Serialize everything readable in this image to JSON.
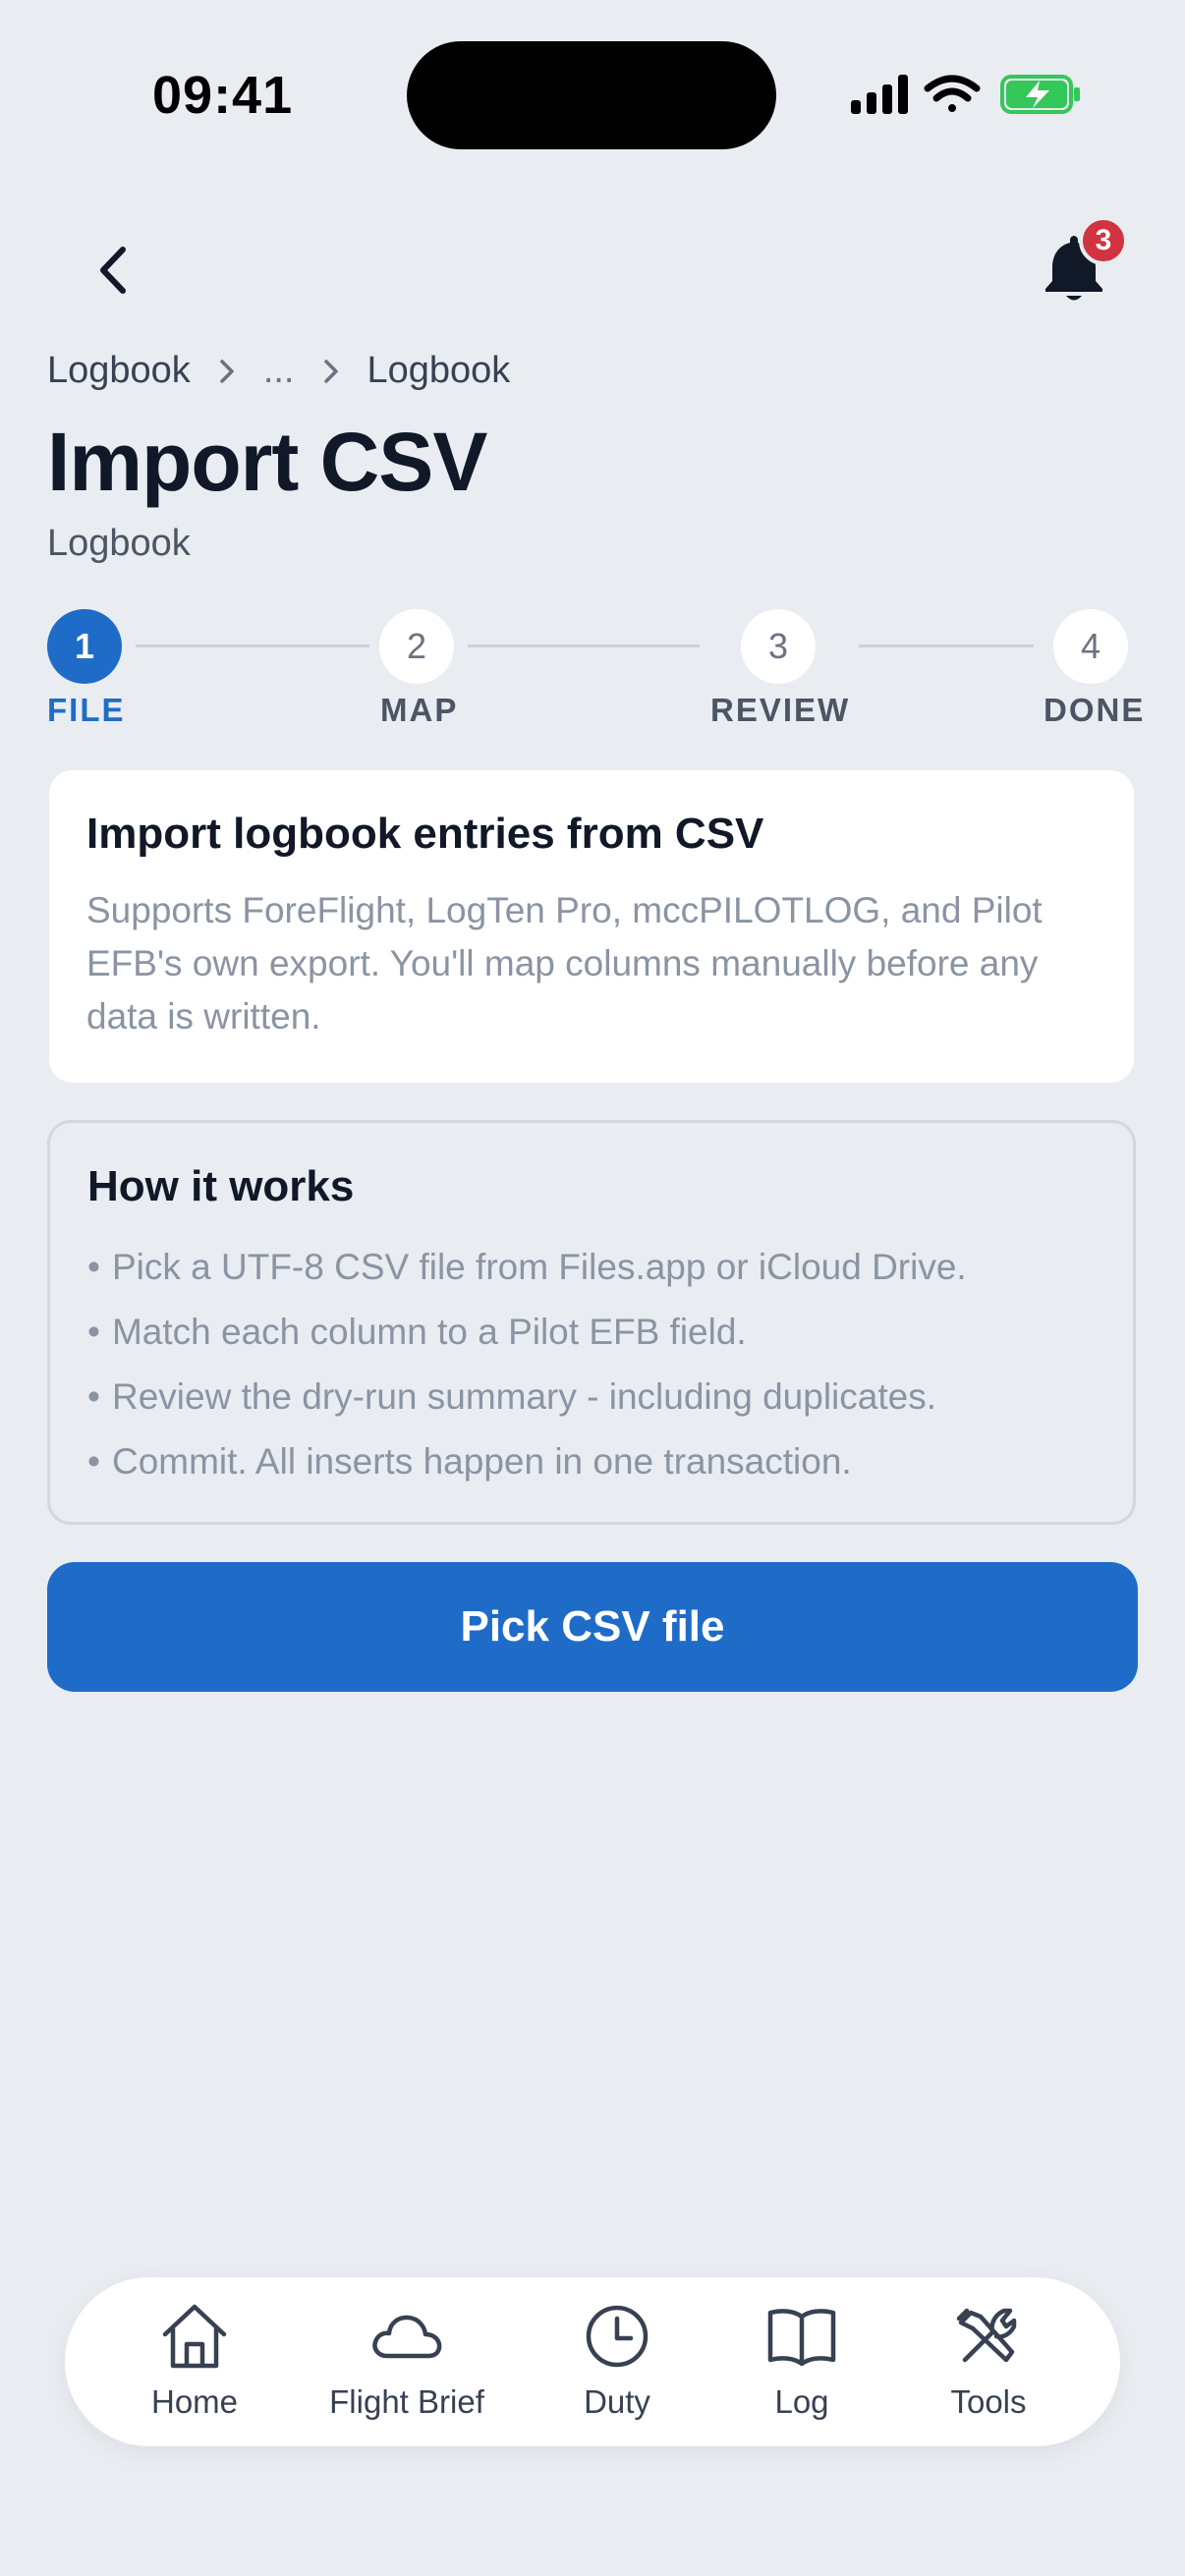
{
  "status_bar": {
    "time": "09:41"
  },
  "header": {
    "notification_count": "3"
  },
  "breadcrumb": {
    "items": [
      "Logbook",
      "...",
      "Logbook"
    ]
  },
  "page": {
    "title": "Import CSV",
    "subtitle": "Logbook"
  },
  "stepper": {
    "active_step": 1,
    "steps": [
      {
        "number": "1",
        "label": "FILE"
      },
      {
        "number": "2",
        "label": "MAP"
      },
      {
        "number": "3",
        "label": "REVIEW"
      },
      {
        "number": "4",
        "label": "DONE"
      }
    ]
  },
  "intro_card": {
    "title": "Import logbook entries from CSV",
    "body": "Supports ForeFlight, LogTen Pro, mccPILOTLOG, and Pilot EFB's own export. You'll map columns manually before any data is written."
  },
  "how_card": {
    "title": "How it works",
    "items": [
      "Pick a UTF-8 CSV file from Files.app or iCloud Drive.",
      "Match each column to a Pilot EFB field.",
      "Review the dry-run summary - including duplicates.",
      "Commit. All inserts happen in one transaction."
    ]
  },
  "primary_action": {
    "label": "Pick CSV file"
  },
  "tab_bar": {
    "items": [
      {
        "label": "Home",
        "icon": "home-icon"
      },
      {
        "label": "Flight Brief",
        "icon": "cloud-icon"
      },
      {
        "label": "Duty",
        "icon": "clock-icon"
      },
      {
        "label": "Log",
        "icon": "book-icon"
      },
      {
        "label": "Tools",
        "icon": "tools-icon"
      }
    ]
  },
  "colors": {
    "accent": "#1E6CC8",
    "badge": "#D23340",
    "background": "#E9ECF1",
    "battery": "#34C759"
  }
}
